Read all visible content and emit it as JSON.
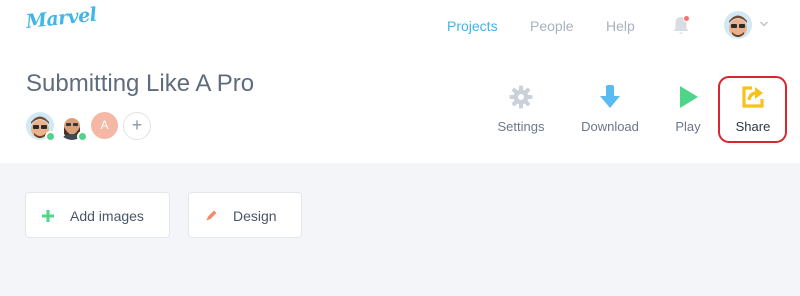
{
  "app": {
    "logo_text": "Marvel",
    "brand_color": "#42b6e6"
  },
  "nav": {
    "items": [
      {
        "label": "Projects",
        "active": true
      },
      {
        "label": "People",
        "active": false
      },
      {
        "label": "Help",
        "active": false
      }
    ],
    "notification_icon": "bell-icon",
    "notification_dot_color": "#ff6d6d",
    "account_menu_icon": "chevron-down-icon"
  },
  "project": {
    "title": "Submitting Like A Pro",
    "collaborators": [
      {
        "type": "photo-avatar",
        "online": true
      },
      {
        "type": "photo-avatar",
        "online": true
      },
      {
        "type": "initial-avatar",
        "initial": "A",
        "online": false
      }
    ],
    "add_collaborator_label": "+"
  },
  "actions": [
    {
      "label": "Settings",
      "icon": "gear-icon",
      "color": "#c9d1db"
    },
    {
      "label": "Download",
      "icon": "download-icon",
      "color": "#58bcf0"
    },
    {
      "label": "Play",
      "icon": "play-icon",
      "color": "#4fd58a"
    },
    {
      "label": "Share",
      "icon": "share-icon",
      "color": "#f8c21c",
      "highlighted": true
    }
  ],
  "canvas": {
    "add_images_label": "Add images",
    "add_images_icon": "plus-icon",
    "design_label": "Design",
    "design_icon": "pencil-icon"
  }
}
